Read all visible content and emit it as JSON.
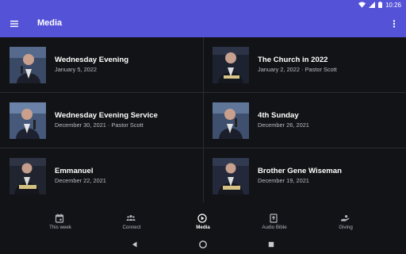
{
  "status": {
    "time": "10:26"
  },
  "app_bar": {
    "title": "Media",
    "menu_icon": "hamburger-menu-icon",
    "more_icon": "more-vert-icon"
  },
  "colors": {
    "primary": "#5452d6",
    "background": "#121316",
    "divider": "#2a2c31",
    "secondary_text": "#b9bcc4"
  },
  "media": [
    {
      "title": "Wednesday Evening",
      "subtitle": "January 5, 2022"
    },
    {
      "title": "The Church in 2022",
      "subtitle": "January 2, 2022 · Pastor Scott"
    },
    {
      "title": "Wednesday Evening Service",
      "subtitle": "December 30, 2021 · Pastor Scott"
    },
    {
      "title": "4th Sunday",
      "subtitle": "December 26, 2021"
    },
    {
      "title": "Emmanuel",
      "subtitle": "December 22, 2021"
    },
    {
      "title": "Brother Gene Wiseman",
      "subtitle": "December 19, 2021"
    }
  ],
  "bottom_nav": [
    {
      "label": "This week",
      "icon": "calendar-icon"
    },
    {
      "label": "Connect",
      "icon": "people-icon"
    },
    {
      "label": "Media",
      "icon": "play-circle-icon",
      "active": true
    },
    {
      "label": "Audio Bible",
      "icon": "book-icon"
    },
    {
      "label": "Giving",
      "icon": "giving-hand-icon"
    }
  ]
}
